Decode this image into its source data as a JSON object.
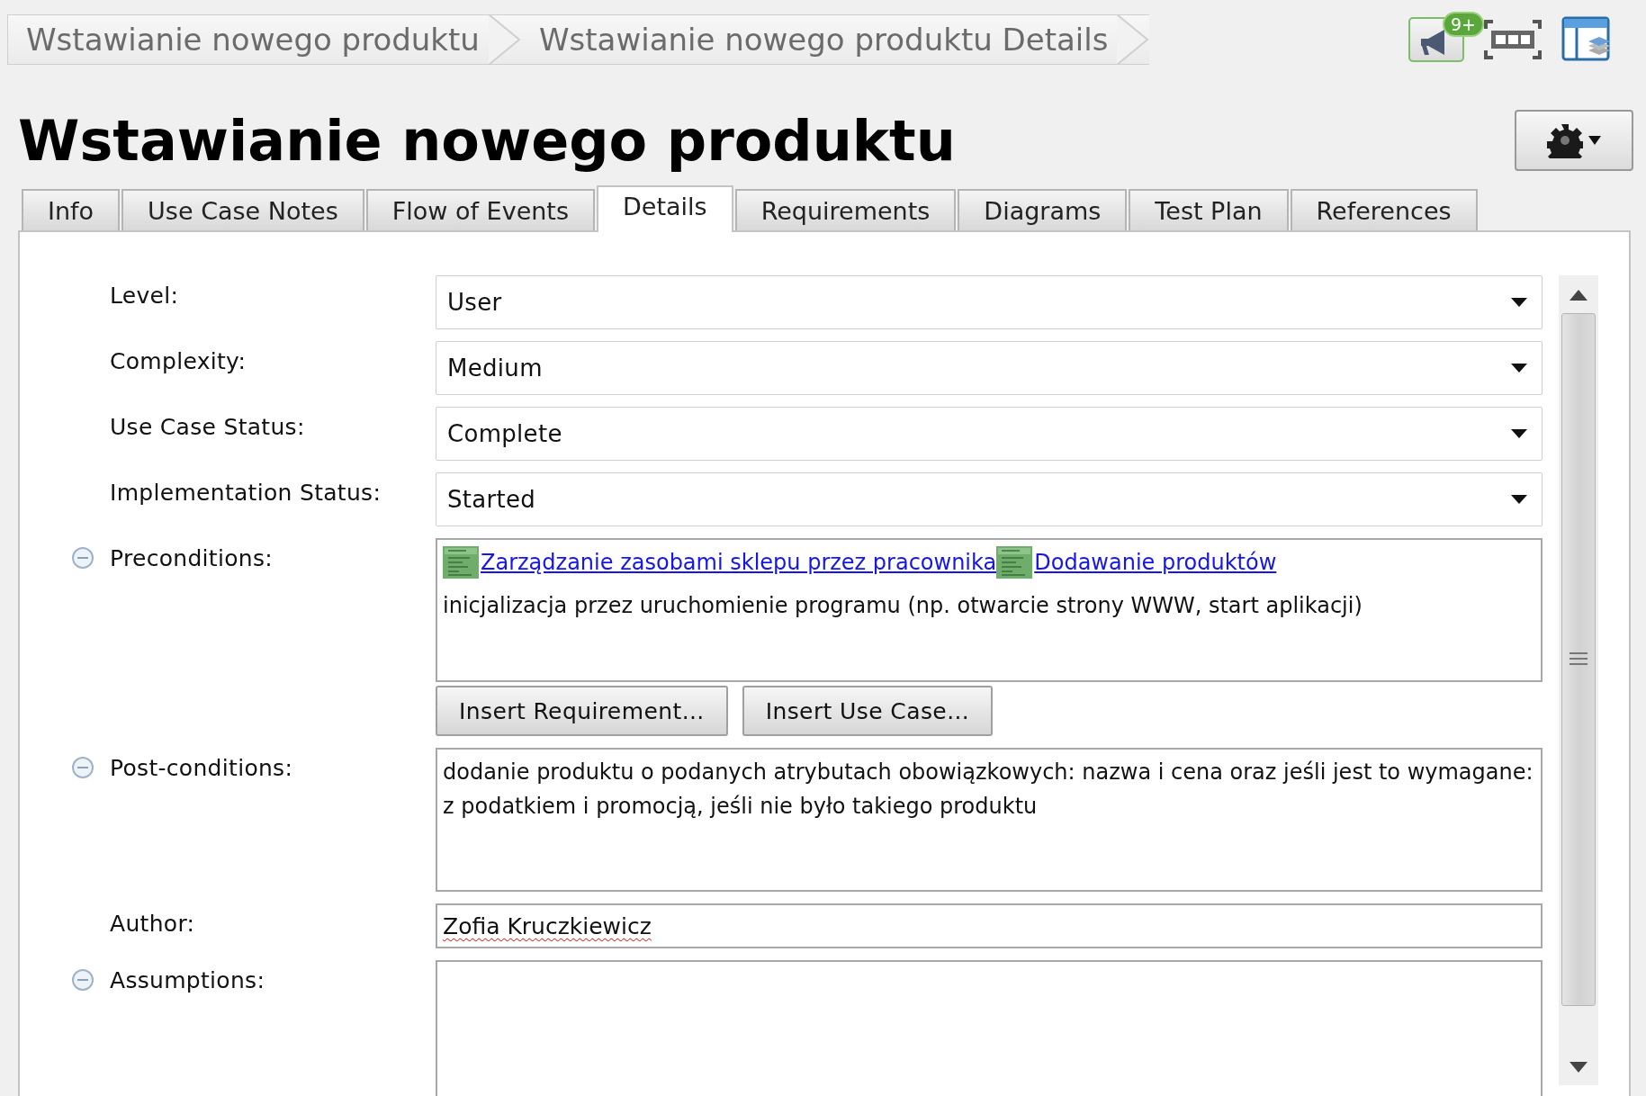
{
  "breadcrumb": [
    {
      "label": "Wstawianie nowego produktu"
    },
    {
      "label": "Wstawianie nowego produktu Details"
    }
  ],
  "notifications": {
    "badge": "9+"
  },
  "title": "Wstawianie nowego produktu",
  "tabs": [
    {
      "label": "Info",
      "selected": false
    },
    {
      "label": "Use Case Notes",
      "selected": false
    },
    {
      "label": "Flow of Events",
      "selected": false
    },
    {
      "label": "Details",
      "selected": true
    },
    {
      "label": "Requirements",
      "selected": false
    },
    {
      "label": "Diagrams",
      "selected": false
    },
    {
      "label": "Test Plan",
      "selected": false
    },
    {
      "label": "References",
      "selected": false
    }
  ],
  "fields": [
    {
      "kind": "dropdown",
      "label": "Level:",
      "value": "User"
    },
    {
      "kind": "dropdown",
      "label": "Complexity:",
      "value": "Medium"
    },
    {
      "kind": "dropdown",
      "label": "Use Case Status:",
      "value": "Complete"
    },
    {
      "kind": "dropdown",
      "label": "Implementation Status:",
      "value": "Started"
    },
    {
      "kind": "richtext",
      "label": "Preconditions:",
      "expanded": true,
      "content": [
        {
          "kind": "link",
          "text": "Zarządzanie zasobami sklepu przez pracownika"
        },
        {
          "kind": "link",
          "text": "Dodawanie produktów"
        },
        {
          "kind": "text",
          "text": "inicjalizacja przez uruchomienie programu (np. otwarcie strony WWW, start aplikacji)"
        }
      ],
      "buttons": [
        "Insert Requirement...",
        "Insert Use Case..."
      ]
    },
    {
      "kind": "richtext",
      "label": "Post-conditions:",
      "expanded": true,
      "content": [
        {
          "kind": "text",
          "text": "dodanie produktu o podanych atrybutach obowiązkowych: nazwa i cena oraz jeśli jest to wymagane: z podatkiem i promocją, jeśli nie było takiego produktu"
        }
      ]
    },
    {
      "kind": "text",
      "label": "Author:",
      "value": "Zofia Kruczkiewicz",
      "misspelled": true
    },
    {
      "kind": "richtext",
      "label": "Assumptions:",
      "expanded": true
    }
  ]
}
